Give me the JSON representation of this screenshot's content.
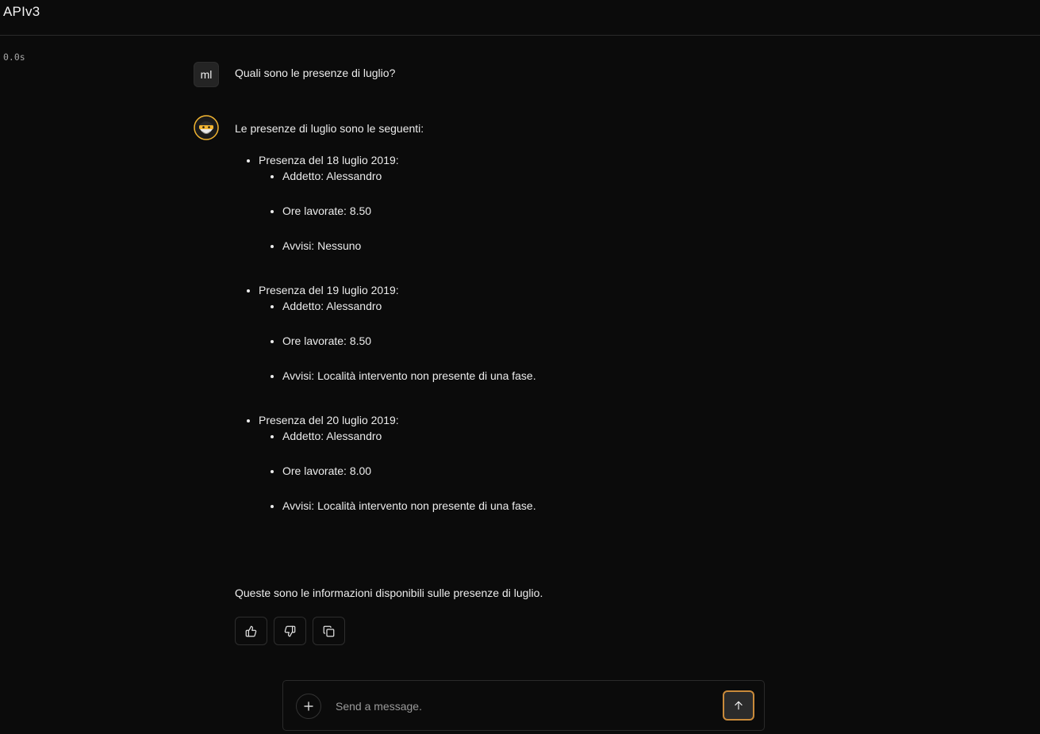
{
  "app": {
    "title": "APIv3"
  },
  "timer": "0.0s",
  "user_message": {
    "avatar_initials": "ml",
    "text": "Quali sono le presenze di luglio?"
  },
  "assistant_message": {
    "avatar_icon": "ninja-bot-avatar-icon",
    "intro": "Le presenze di luglio sono le seguenti:",
    "entries": [
      {
        "title": "Presenza del 18 luglio 2019:",
        "details": [
          "Addetto: Alessandro",
          "Ore lavorate: 8.50",
          "Avvisi: Nessuno"
        ]
      },
      {
        "title": "Presenza del 19 luglio 2019:",
        "details": [
          "Addetto: Alessandro",
          "Ore lavorate: 8.50",
          "Avvisi: Località intervento non presente di una fase."
        ]
      },
      {
        "title": "Presenza del 20 luglio 2019:",
        "details": [
          "Addetto: Alessandro",
          "Ore lavorate: 8.00",
          "Avvisi: Località intervento non presente di una fase."
        ]
      }
    ],
    "outro": "Queste sono le informazioni disponibili sulle presenze di luglio.",
    "actions": [
      "thumbs-up-icon",
      "thumbs-down-icon",
      "copy-icon"
    ]
  },
  "composer": {
    "placeholder": "Send a message.",
    "plus_icon": "plus-icon",
    "send_icon": "arrow-up-icon"
  },
  "colors": {
    "background": "#0b0b0b",
    "send_button_border": "#c98a3a",
    "avatar_bot_accent": "#f2b531"
  }
}
